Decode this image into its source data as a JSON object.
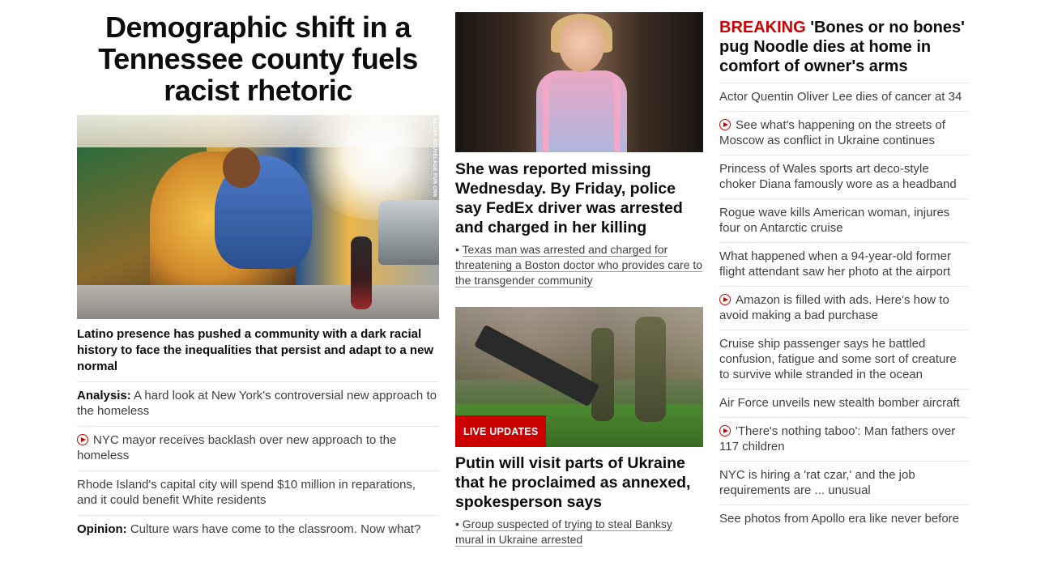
{
  "left": {
    "headline": "Demographic shift in a Tennessee county fuels racist rhetoric",
    "photo_credit": "ELIJAH NOUVELAGE FOR CNN",
    "lead_description": "Latino presence has pushed a community with a dark racial history to face the inequalities that persist and adapt to a new normal",
    "items": [
      {
        "prefix": "Analysis:",
        "text": " A hard look at New York's controversial new approach to the homeless",
        "video": false
      },
      {
        "prefix": "",
        "text": "NYC mayor receives backlash over new approach to the homeless",
        "video": true
      },
      {
        "prefix": "",
        "text": "Rhode Island's capital city will spend $10 million in reparations, and it could benefit White residents",
        "video": false
      },
      {
        "prefix": "Opinion:",
        "text": " Culture wars have come to the classroom. Now what?",
        "video": false
      }
    ]
  },
  "mid": {
    "story1": {
      "headline": "She was reported missing Wednesday. By Friday, police say FedEx driver was arrested and charged in her killing",
      "sub": "Texas man was arrested and charged for threatening a Boston doctor who provides care to the transgender community"
    },
    "story2": {
      "badge": "LIVE UPDATES",
      "headline": "Putin will visit parts of Ukraine that he proclaimed as annexed, spokesperson says",
      "sub": "Group suspected of trying to steal Banksy mural in Ukraine arrested"
    }
  },
  "right": {
    "breaking_flag": "BREAKING",
    "breaking_text": " 'Bones or no bones' pug Noodle dies at home in comfort of owner's arms",
    "items": [
      {
        "text": "Actor Quentin Oliver Lee dies of cancer at 34",
        "video": false
      },
      {
        "text": "See what's happening on the streets of Moscow as conflict in Ukraine continues",
        "video": true
      },
      {
        "text": "Princess of Wales sports art deco-style choker Diana famously wore as a headband",
        "video": false
      },
      {
        "text": "Rogue wave kills American woman, injures four on Antarctic cruise",
        "video": false
      },
      {
        "text": "What happened when a 94-year-old former flight attendant saw her photo at the airport",
        "video": false
      },
      {
        "text": "Amazon is filled with ads. Here's how to avoid making a bad purchase",
        "video": true
      },
      {
        "text": "Cruise ship passenger says he battled confusion, fatigue and some sort of creature to survive while stranded in the ocean",
        "video": false
      },
      {
        "text": "Air Force unveils new stealth bomber aircraft",
        "video": false
      },
      {
        "text": "'There's nothing taboo': Man fathers over 117 children",
        "video": true
      },
      {
        "text": "NYC is hiring a 'rat czar,' and the job requirements are ... unusual",
        "video": false
      },
      {
        "text": "See photos from Apollo era like never before",
        "video": false
      }
    ]
  },
  "colors": {
    "accent_red": "#cc0000",
    "text_dark": "#0c0c0c",
    "text_muted": "#404040",
    "divider": "#e6e6e6"
  }
}
